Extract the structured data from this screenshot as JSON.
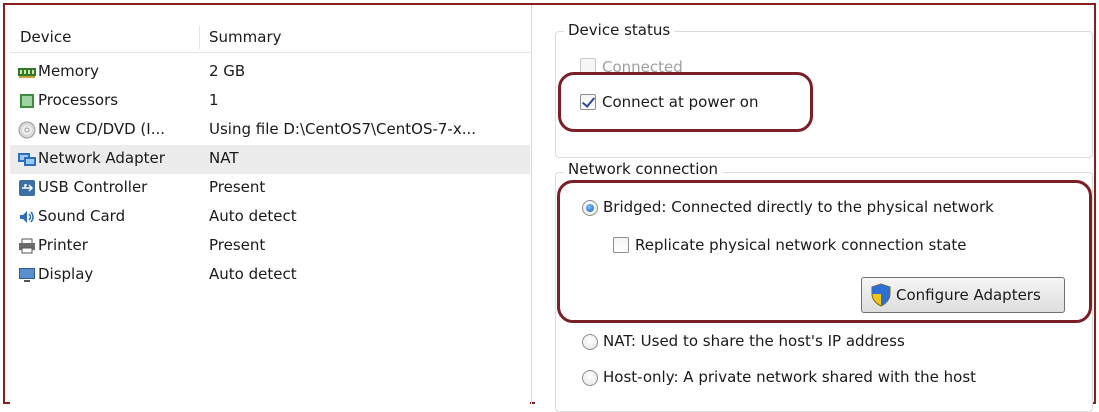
{
  "device_list": {
    "header": {
      "device": "Device",
      "summary": "Summary"
    },
    "rows": [
      {
        "name": "Memory",
        "summary": "2 GB",
        "icon": "memory-icon"
      },
      {
        "name": "Processors",
        "summary": "1",
        "icon": "processor-icon"
      },
      {
        "name": "New CD/DVD (I...",
        "summary": "Using file D:\\CentOS7\\CentOS-7-x...",
        "icon": "cd-dvd-icon"
      },
      {
        "name": "Network Adapter",
        "summary": "NAT",
        "icon": "network-adapter-icon"
      },
      {
        "name": "USB Controller",
        "summary": "Present",
        "icon": "usb-icon"
      },
      {
        "name": "Sound Card",
        "summary": "Auto detect",
        "icon": "sound-card-icon"
      },
      {
        "name": "Printer",
        "summary": "Present",
        "icon": "printer-icon"
      },
      {
        "name": "Display",
        "summary": "Auto detect",
        "icon": "display-icon"
      }
    ],
    "selected_row": "Network Adapter"
  },
  "device_status": {
    "title": "Device status",
    "connected": {
      "label": "Connected",
      "checked": false,
      "enabled": false
    },
    "connect_at_power_on": {
      "label": "Connect at power on",
      "checked": true
    }
  },
  "network_connection": {
    "title": "Network connection",
    "bridged": {
      "label": "Bridged: Connected directly to the physical network",
      "selected": true
    },
    "replicate": {
      "label": "Replicate physical network connection state",
      "checked": false
    },
    "configure_button": {
      "label": "Configure Adapters",
      "icon": "uac-shield-icon"
    },
    "nat": {
      "label": "NAT: Used to share the host's IP address",
      "selected": false
    },
    "host_only": {
      "label": "Host-only: A private network shared with the host",
      "selected": false
    }
  },
  "colors": {
    "annotation_border": "#7a1f26",
    "selected_row": "#ececec",
    "frame_border": "#8a1f1f"
  }
}
